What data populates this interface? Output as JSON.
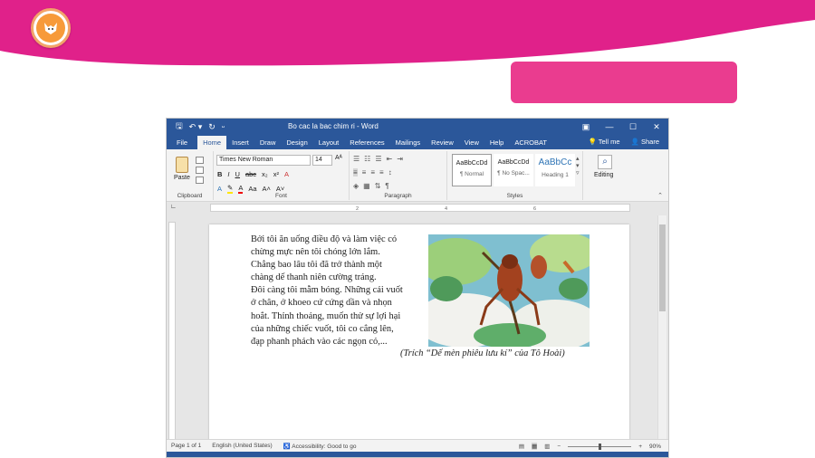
{
  "colors": {
    "brand_pink": "#ea3c8f",
    "word_blue": "#2b579a",
    "logo_orange": "#f79a3a"
  },
  "window": {
    "title": "Bo cac la bac chim ri - Word",
    "qat_icons": [
      "save-icon",
      "undo-icon",
      "redo-icon",
      "customize-icon"
    ],
    "controls": [
      "ribbon-options-icon",
      "minimize-icon",
      "maximize-icon",
      "close-icon"
    ]
  },
  "tabs": [
    {
      "label": "File"
    },
    {
      "label": "Home"
    },
    {
      "label": "Insert"
    },
    {
      "label": "Draw"
    },
    {
      "label": "Design"
    },
    {
      "label": "Layout"
    },
    {
      "label": "References"
    },
    {
      "label": "Mailings"
    },
    {
      "label": "Review"
    },
    {
      "label": "View"
    },
    {
      "label": "Help"
    },
    {
      "label": "ACROBAT"
    }
  ],
  "tabs_right": {
    "tell_me": "Tell me",
    "share": "Share"
  },
  "ribbon": {
    "clipboard": {
      "paste": "Paste",
      "group": "Clipboard"
    },
    "font": {
      "name": "Times New Roman",
      "size": "14",
      "group": "Font"
    },
    "paragraph": {
      "group": "Paragraph"
    },
    "styles": {
      "group": "Styles",
      "items": [
        {
          "sample": "AaBbCcDd",
          "name": "¶ Normal"
        },
        {
          "sample": "AaBbCcDd",
          "name": "¶ No Spac..."
        },
        {
          "sample": "AaBbCc",
          "name": "Heading 1"
        }
      ]
    },
    "editing": {
      "label": "Editing"
    }
  },
  "document": {
    "lines": [
      "Bởi tôi ăn uống điều độ và làm việc có",
      "chừng mực nên tôi chóng lớn lắm.",
      "Chẳng bao lâu tôi đã trở thành một",
      "chàng dế thanh niên cường tráng.",
      "Đôi càng tôi mẫm bóng. Những cái vuốt",
      "ở chân, ở khoeo cứ cứng dần và nhọn",
      "hoắt. Thỉnh thoảng, muốn thử sự lợi hại",
      "của những chiếc vuốt, tôi co cẳng lên,",
      "đạp phanh phách vào các ngọn cỏ,..."
    ],
    "caption": "(Trích “Dế mèn phiêu lưu kí” của Tô Hoài)"
  },
  "status": {
    "page": "Page 1 of 1",
    "language": "English (United States)",
    "accessibility": "Accessibility: Good to go",
    "zoom": "90%"
  }
}
